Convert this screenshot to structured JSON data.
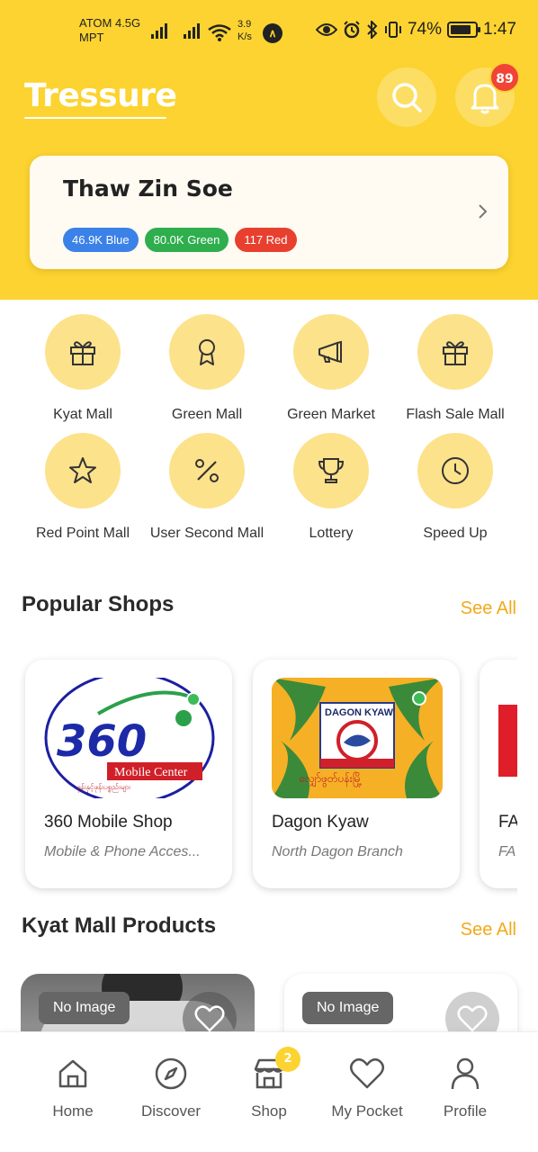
{
  "status_bar": {
    "carrier_line1": "ATOM 4.5G",
    "carrier_line2": "MPT",
    "speed_value": "3.9",
    "speed_unit": "K/s",
    "battery": "74%",
    "time": "1:47"
  },
  "header": {
    "brand": "Tressure",
    "notification_count": "89",
    "icons": [
      "search-icon",
      "bell-icon"
    ]
  },
  "user": {
    "name": "Thaw Zin Soe",
    "points": [
      {
        "label": "46.9K Blue",
        "color": "#3b82e8"
      },
      {
        "label": "80.0K Green",
        "color": "#2fae4e"
      },
      {
        "label": "117 Red",
        "color": "#e8402f"
      }
    ]
  },
  "categories": [
    {
      "label": "Kyat Mall",
      "icon": "gift-icon"
    },
    {
      "label": "Green Mall",
      "icon": "award-icon"
    },
    {
      "label": "Green Market",
      "icon": "megaphone-icon"
    },
    {
      "label": "Flash Sale Mall",
      "icon": "gift-icon"
    },
    {
      "label": "Red Point Mall",
      "icon": "star-icon"
    },
    {
      "label": "User Second Mall",
      "icon": "percent-icon"
    },
    {
      "label": "Lottery",
      "icon": "trophy-icon"
    },
    {
      "label": "Speed Up",
      "icon": "clock-icon"
    }
  ],
  "popular_shops": {
    "title": "Popular Shops",
    "see_all": "See All",
    "shops": [
      {
        "name": "360 Mobile Shop",
        "subtitle": "Mobile & Phone Acces...",
        "logo_text": "360",
        "logo_sub": "Mobile Center",
        "logo_script": "ဖုန်းနှင့်ဖုန်းပစ္စည်းများ"
      },
      {
        "name": "Dagon Kyaw",
        "subtitle": "North Dagon Branch",
        "logo_text": "DAGON KYAW",
        "logo_script": "လျှော်ဖွတ်ပန်းမြို့"
      },
      {
        "name": "FA",
        "subtitle": "FA"
      }
    ]
  },
  "kyat_mall": {
    "title": "Kyat Mall Products",
    "see_all": "See All",
    "products": [
      {
        "image_label": "No Image"
      },
      {
        "image_label": "No Image"
      }
    ]
  },
  "bottom_nav": {
    "items": [
      {
        "label": "Home",
        "icon": "home-icon"
      },
      {
        "label": "Discover",
        "icon": "compass-icon"
      },
      {
        "label": "Shop",
        "icon": "store-icon",
        "badge": "2"
      },
      {
        "label": "My Pocket",
        "icon": "heart-icon"
      },
      {
        "label": "Profile",
        "icon": "user-icon"
      }
    ]
  },
  "colors": {
    "primary_yellow": "#fcd330",
    "icon_circle": "#fde28c",
    "accent_orange": "#f2a917",
    "badge_red": "#f24336",
    "online_green": "#3dbb58"
  }
}
